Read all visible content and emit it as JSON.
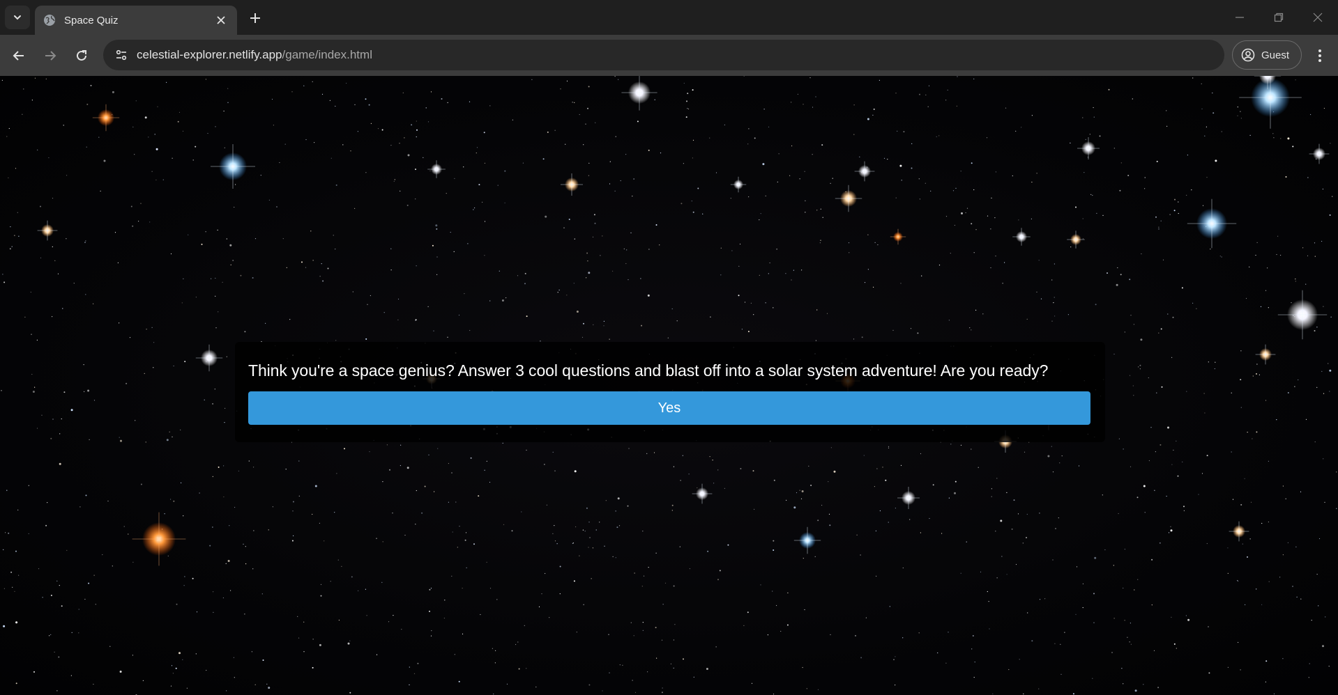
{
  "browser": {
    "tab": {
      "title": "Space Quiz",
      "favicon": "globe-icon"
    },
    "address_bar": {
      "host": "celestial-explorer.netlify.app",
      "path": "/game/index.html"
    },
    "profile": {
      "label": "Guest",
      "icon": "account-circle-icon"
    },
    "icons": {
      "tab_search": "chevron-down-icon",
      "tab_close": "close-icon",
      "new_tab": "plus-icon",
      "back": "arrow-left-icon",
      "forward": "arrow-right-icon",
      "reload": "reload-icon",
      "site_info": "tune-icon",
      "menu": "more-vertical-icon",
      "minimize": "minimize-icon",
      "restore": "restore-icon",
      "close_window": "close-icon"
    }
  },
  "page": {
    "background": "starry night sky",
    "quiz": {
      "question": "Think you're a space genius? Answer 3 cool questions and blast off into a solar system adventure! Are you ready?",
      "answer_button": "Yes"
    }
  },
  "colors": {
    "button": "#3498db",
    "panel": "#000000",
    "chrome_dark": "#1f1f1f",
    "chrome_toolbar": "#3c3c3c"
  }
}
